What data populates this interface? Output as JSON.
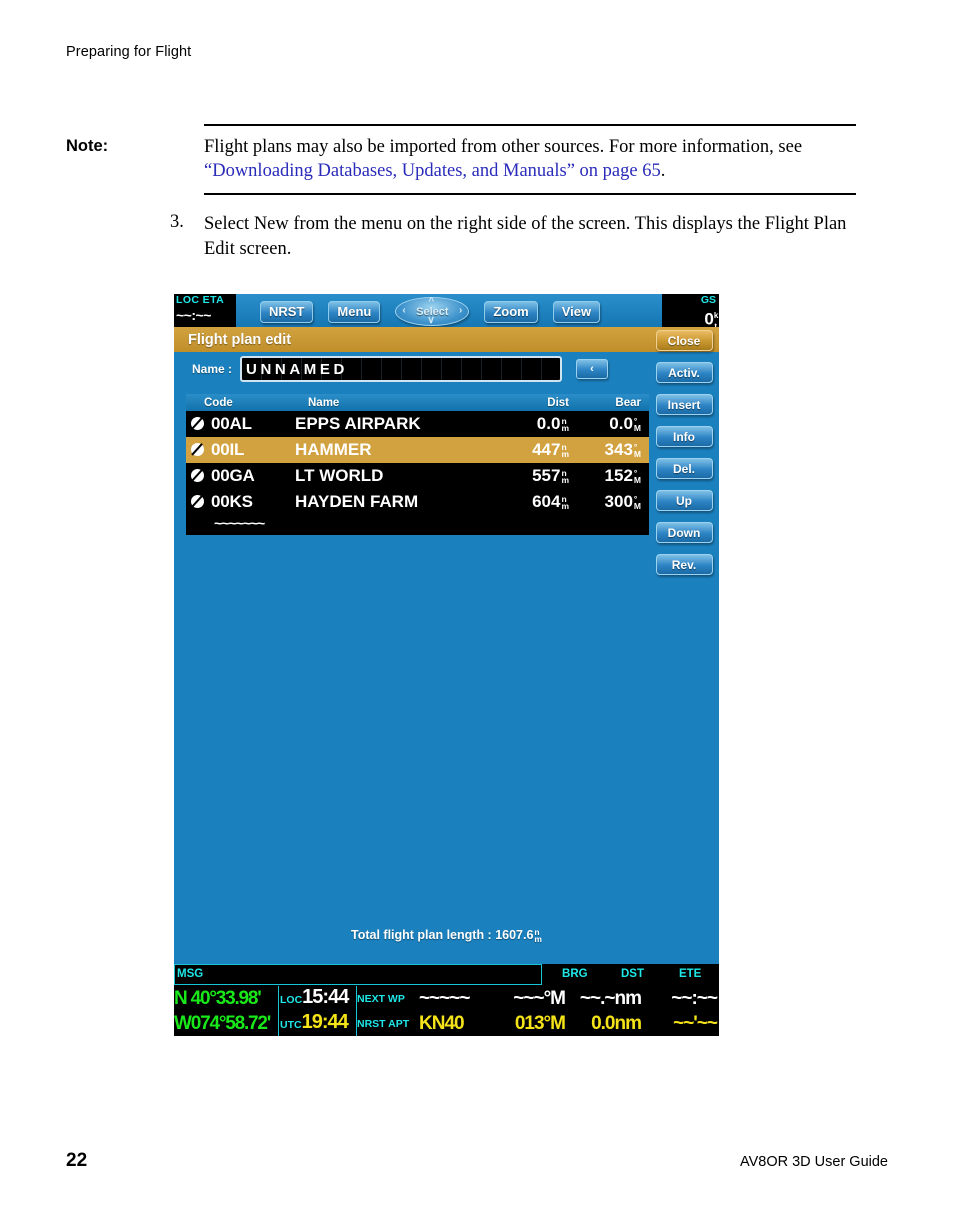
{
  "document": {
    "running_head": "Preparing for Flight",
    "note": {
      "label": "Note:",
      "text_before": "Flight plans may also be imported from other sources. For more information, see ",
      "link_text": "“Downloading Databases, Updates, and Manuals” on page 65",
      "text_after": "."
    },
    "step": {
      "number": "3.",
      "text": "Select New from the menu on the right side of the screen. This displays the Flight Plan Edit screen."
    },
    "footer": {
      "page_number": "22",
      "guide_title": "AV8OR 3D User Guide"
    }
  },
  "device": {
    "topbar": {
      "loc_eta_label": "LOC ETA",
      "loc_eta_value": "~~:~~",
      "buttons": [
        {
          "label": "NRST",
          "name": "nrst-button"
        },
        {
          "label": "Menu",
          "name": "menu-button"
        }
      ],
      "select_pad_label": "Select",
      "buttons_right": [
        {
          "label": "Zoom",
          "name": "zoom-button"
        },
        {
          "label": "View",
          "name": "view-button"
        }
      ],
      "gs_label": "GS",
      "gs_value": "0",
      "gs_unit_top": "k",
      "gs_unit_bottom": "t"
    },
    "titlebar": {
      "title": "Flight plan edit",
      "close_label": "Close"
    },
    "name_row": {
      "label": "Name :",
      "value": "UNNAMED",
      "back_label": "‹"
    },
    "table": {
      "headers": {
        "code": "Code",
        "name": "Name",
        "dist": "Dist",
        "bear": "Bear"
      },
      "rows": [
        {
          "icon": "private-airport-icon",
          "code": "00AL",
          "name": "EPPS AIRPARK",
          "dist": "0.0",
          "dist_unit_top": "n",
          "dist_unit_bottom": "m",
          "bear": "0.0",
          "bear_unit_top": "°",
          "bear_unit_bottom": "M",
          "selected": false
        },
        {
          "icon": "private-airport-icon",
          "code": "00IL",
          "name": "HAMMER",
          "dist": "447",
          "dist_unit_top": "n",
          "dist_unit_bottom": "m",
          "bear": "343",
          "bear_unit_top": "°",
          "bear_unit_bottom": "M",
          "selected": true
        },
        {
          "icon": "private-airport-icon",
          "code": "00GA",
          "name": "LT WORLD",
          "dist": "557",
          "dist_unit_top": "n",
          "dist_unit_bottom": "m",
          "bear": "152",
          "bear_unit_top": "°",
          "bear_unit_bottom": "M",
          "selected": false
        },
        {
          "icon": "private-airport-icon",
          "code": "00KS",
          "name": "HAYDEN FARM",
          "dist": "604",
          "dist_unit_top": "n",
          "dist_unit_bottom": "m",
          "bear": "300",
          "bear_unit_top": "°",
          "bear_unit_bottom": "M",
          "selected": false
        }
      ],
      "empty_row": "~~~~~~~"
    },
    "rail_buttons": [
      {
        "label": "Activ.",
        "name": "activate-button"
      },
      {
        "label": "Insert",
        "name": "insert-button"
      },
      {
        "label": "Info",
        "name": "info-button"
      },
      {
        "label": "Del.",
        "name": "delete-button"
      },
      {
        "label": "Up",
        "name": "move-up-button"
      },
      {
        "label": "Down",
        "name": "move-down-button"
      },
      {
        "label": "Rev.",
        "name": "reverse-button"
      }
    ],
    "total": {
      "text": "Total flight plan length : 1607.6",
      "unit_top": "n",
      "unit_bottom": "m"
    },
    "status": {
      "msg_label": "MSG",
      "col_brg": "BRG",
      "col_dst": "DST",
      "col_ete": "ETE",
      "lat": "N  40°33.98'",
      "lon": "W074°58.72'",
      "loc_label": "LOC",
      "loc_time": "15:44",
      "utc_label": "UTC",
      "utc_time": "19:44",
      "next_wp_label": "NEXT WP",
      "next_wp_value": "~~~~~",
      "next_wp_brg": "~~~°M",
      "next_wp_dst": "~~.~nm",
      "next_wp_ete": "~~:~~",
      "nrst_apt_label": "NRST APT",
      "nrst_apt_value": "KN40",
      "nrst_apt_brg": "013°M",
      "nrst_apt_dst": "0.0nm",
      "nrst_apt_ete": "~~'~~"
    }
  },
  "colors": {
    "device_blue": "#1b81be",
    "title_gold": "#c08f2a",
    "cyan": "#1fe8e8",
    "green": "#19e819",
    "yellow": "#f4e318",
    "link_blue": "#2b2bbb"
  }
}
